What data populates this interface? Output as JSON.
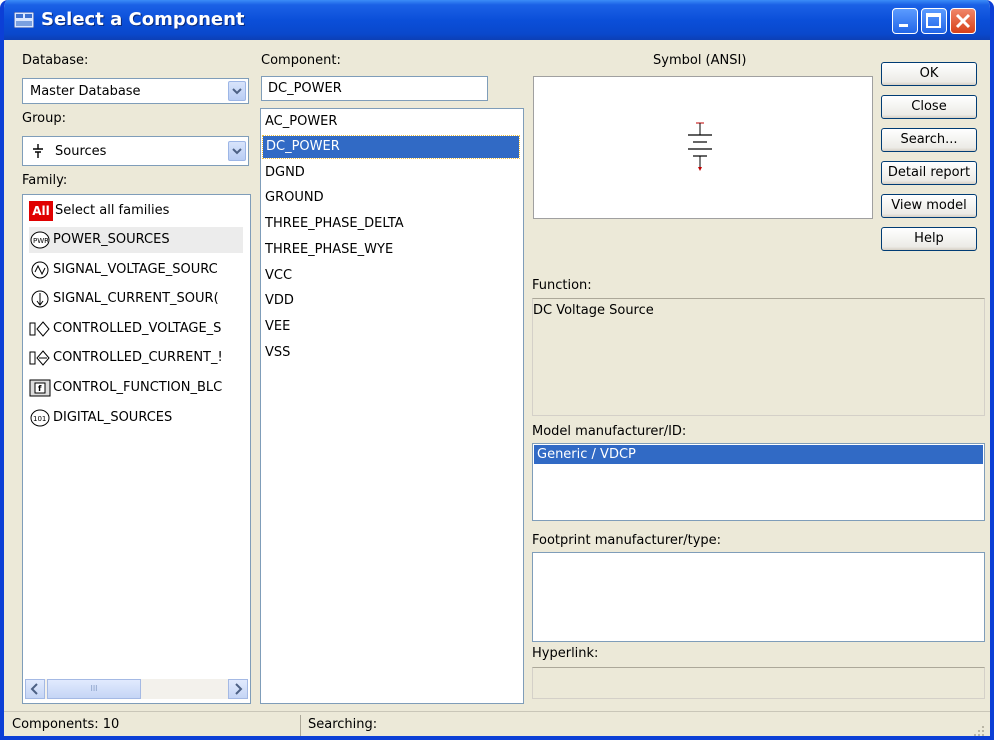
{
  "window": {
    "title": "Select a Component"
  },
  "database": {
    "label": "Database:",
    "value": "Master Database"
  },
  "group": {
    "label": "Group:",
    "value": "Sources"
  },
  "family": {
    "label": "Family:",
    "items": [
      {
        "label": "Select all families",
        "icon": "all-families-icon"
      },
      {
        "label": "POWER_SOURCES",
        "icon": "power-source-icon"
      },
      {
        "label": "SIGNAL_VOLTAGE_SOURC",
        "icon": "signal-voltage-icon"
      },
      {
        "label": "SIGNAL_CURRENT_SOUR(",
        "icon": "signal-current-icon"
      },
      {
        "label": "CONTROLLED_VOLTAGE_S",
        "icon": "controlled-voltage-icon"
      },
      {
        "label": "CONTROLLED_CURRENT_!",
        "icon": "controlled-current-icon"
      },
      {
        "label": "CONTROL_FUNCTION_BLC",
        "icon": "control-function-icon"
      },
      {
        "label": "DIGITAL_SOURCES",
        "icon": "digital-source-icon"
      }
    ],
    "all_badge": "All",
    "scroll_grip": "III"
  },
  "component": {
    "label": "Component:",
    "value": "DC_POWER",
    "items": [
      "AC_POWER",
      "DC_POWER",
      "DGND",
      "GROUND",
      "THREE_PHASE_DELTA",
      "THREE_PHASE_WYE",
      "VCC",
      "VDD",
      "VEE",
      "VSS"
    ]
  },
  "symbol": {
    "label": "Symbol (ANSI)"
  },
  "buttons": {
    "ok": "OK",
    "close": "Close",
    "search": "Search...",
    "detail": "Detail report",
    "view_model": "View model",
    "help": "Help"
  },
  "function": {
    "label": "Function:",
    "value": "DC Voltage Source"
  },
  "model": {
    "label": "Model manufacturer/ID:",
    "items": [
      "Generic / VDCP"
    ]
  },
  "footprint": {
    "label": "Footprint manufacturer/type:"
  },
  "hyperlink": {
    "label": "Hyperlink:"
  },
  "status": {
    "components": "Components: 10",
    "searching": "Searching:"
  },
  "colors": {
    "selection": "#316ac5",
    "title_bar": "#0b4fd9",
    "face": "#ece9d8"
  }
}
